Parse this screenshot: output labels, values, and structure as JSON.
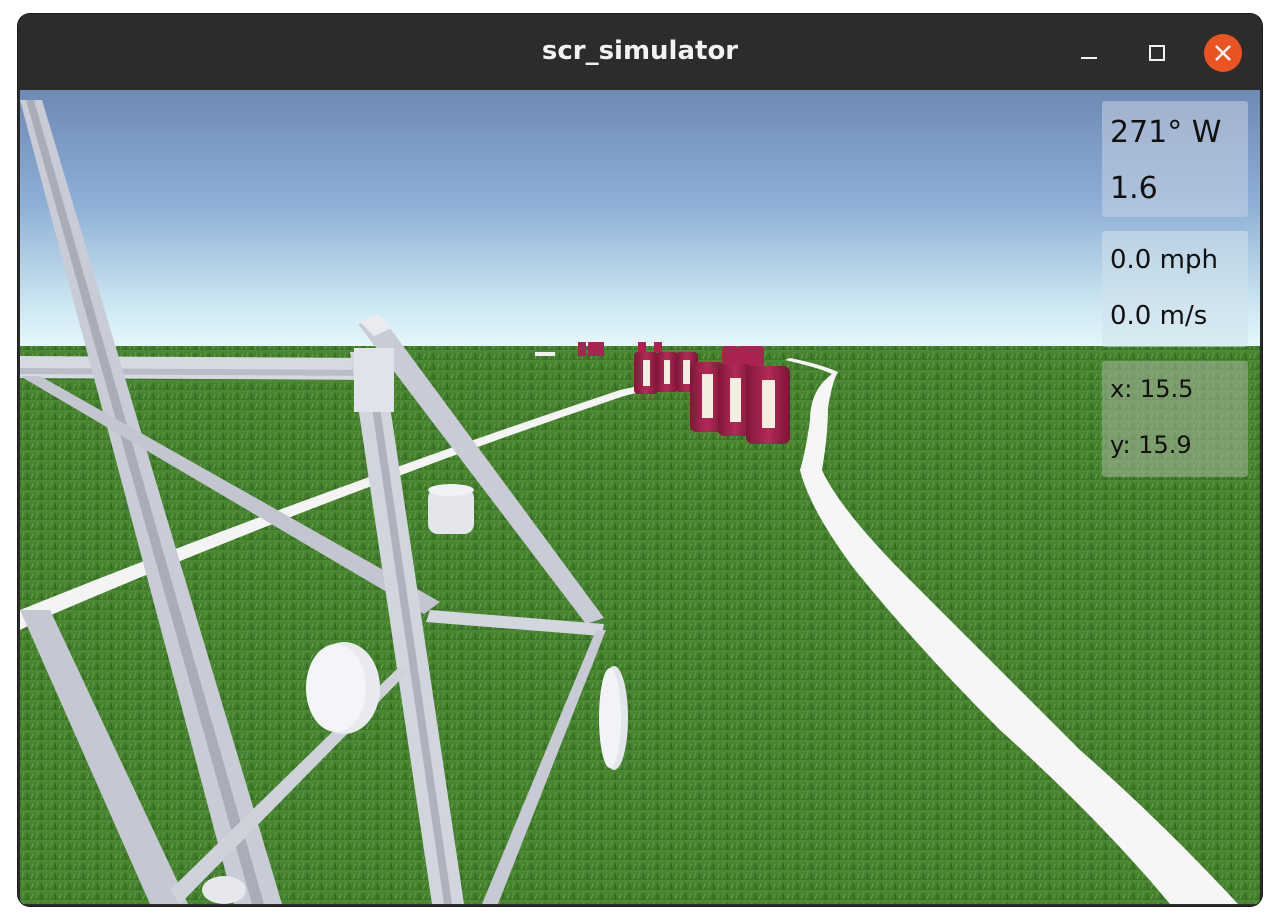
{
  "window": {
    "title": "scr_simulator"
  },
  "titlebar_buttons": [
    {
      "name": "minimize",
      "icon": "minimize-icon"
    },
    {
      "name": "maximize",
      "icon": "maximize-icon"
    },
    {
      "name": "close",
      "icon": "close-icon",
      "color": "#e95420"
    }
  ],
  "hud": {
    "heading": "271° W",
    "heading_value": "1.6",
    "speed_mph": "0.0 mph",
    "speed_ms": "0.0 m/s",
    "pos_x": "x: 15.5",
    "pos_y": "y: 15.9"
  },
  "colors": {
    "titlebar": "#2c2c2c",
    "sky_top": "#6d8bb8",
    "sky_horizon": "#dff3f8",
    "grass": "#3f7f2a",
    "barrel": "#a8234f",
    "lane_line": "#ffffff",
    "frame": "#c4c8d4"
  }
}
